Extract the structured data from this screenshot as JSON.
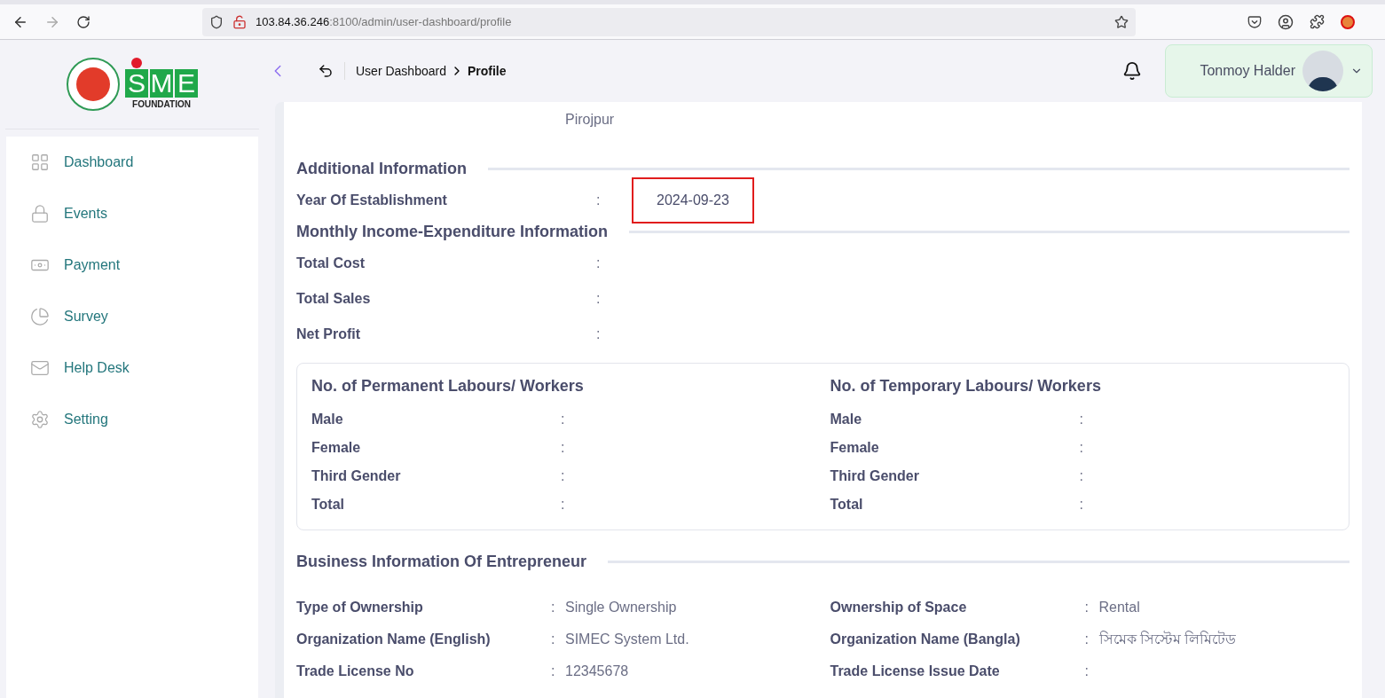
{
  "browser": {
    "url_host": "103.84.36.246",
    "url_rest": ":8100/admin/user-dashboard/profile"
  },
  "header": {
    "breadcrumb": [
      {
        "label": "User Dashboard",
        "current": false
      },
      {
        "label": "Profile",
        "current": true
      }
    ],
    "user_name": "Tonmoy Halder",
    "logo_letters": [
      "S",
      "M",
      "E"
    ],
    "logo_text": "FOUNDATION"
  },
  "sidebar": {
    "items": [
      {
        "label": "Dashboard"
      },
      {
        "label": "Events"
      },
      {
        "label": "Payment"
      },
      {
        "label": "Survey"
      },
      {
        "label": "Help Desk"
      },
      {
        "label": "Setting"
      }
    ]
  },
  "address_tail": "Pirojpur",
  "additional": {
    "title": "Additional Information",
    "rows": [
      {
        "label": "Year Of Establishment",
        "sep": ":",
        "value": "2024-09-23",
        "highlighted": true
      }
    ]
  },
  "income": {
    "title": "Monthly Income-Expenditure Information",
    "rows": [
      {
        "label": "Total Cost",
        "sep": ":"
      },
      {
        "label": "Total Sales",
        "sep": ":"
      },
      {
        "label": "Net Profit",
        "sep": ":"
      }
    ]
  },
  "labour": [
    {
      "title": "No. of Permanent Labours/ Workers",
      "rows": [
        {
          "label": "Male",
          "sep": ":"
        },
        {
          "label": "Female",
          "sep": ":"
        },
        {
          "label": "Third Gender",
          "sep": ":"
        },
        {
          "label": "Total",
          "sep": ":"
        }
      ]
    },
    {
      "title": "No. of Temporary Labours/ Workers",
      "rows": [
        {
          "label": "Male",
          "sep": ":"
        },
        {
          "label": "Female",
          "sep": ":"
        },
        {
          "label": "Third Gender",
          "sep": ":"
        },
        {
          "label": "Total",
          "sep": ":"
        }
      ]
    }
  ],
  "business": {
    "title": "Business Information Of Entrepreneur",
    "rows": [
      {
        "label": "Type of Ownership",
        "sep": ":",
        "value": "Single Ownership"
      },
      {
        "label": "Ownership of Space",
        "sep": ":",
        "value": "Rental"
      },
      {
        "label": "Organization Name (English)",
        "sep": ":",
        "value": "SIMEC System Ltd."
      },
      {
        "label": "Organization Name (Bangla)",
        "sep": ":",
        "value": "সিমেক সিস্টেম লিমিটেড"
      },
      {
        "label": "Trade License No",
        "sep": ":",
        "value": "12345678"
      },
      {
        "label": "Trade License Issue Date",
        "sep": ":"
      }
    ]
  }
}
